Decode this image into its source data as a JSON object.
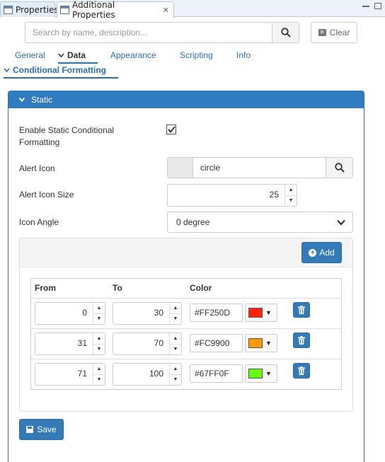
{
  "tabs": [
    {
      "label": "Properties",
      "active": false
    },
    {
      "label": "Additional Properties",
      "active": true,
      "close_icon": "close-icon"
    }
  ],
  "search": {
    "placeholder": "Search by name, description...",
    "value": ""
  },
  "clear_label": "Clear",
  "nav": {
    "items": [
      "General",
      "Data",
      "Appearance",
      "Scripting",
      "Info"
    ],
    "active": "Data"
  },
  "section_title": "Conditional Formatting",
  "panel_title": "Static",
  "form": {
    "enable_label_line1": "Enable Static Conditional",
    "enable_label_line2": "Formatting",
    "enable_checked": true,
    "alert_icon_label": "Alert Icon",
    "alert_icon_value": "circle",
    "alert_icon_size_label": "Alert Icon Size",
    "alert_icon_size_value": "25",
    "icon_angle_label": "Icon Angle",
    "icon_angle_value": "0 degree"
  },
  "add_label": "Add",
  "table": {
    "headers": [
      "From",
      "To",
      "Color"
    ],
    "rows": [
      {
        "from": "0",
        "to": "30",
        "hex": "#FF250D",
        "color": "#FF250D"
      },
      {
        "from": "31",
        "to": "70",
        "hex": "#FC9900",
        "color": "#FC9900"
      },
      {
        "from": "71",
        "to": "100",
        "hex": "#67FF0F",
        "color": "#67FF0F"
      }
    ]
  },
  "save_label": "Save",
  "colors": {
    "accent": "#2f7bbf",
    "button": "#337ab7"
  }
}
